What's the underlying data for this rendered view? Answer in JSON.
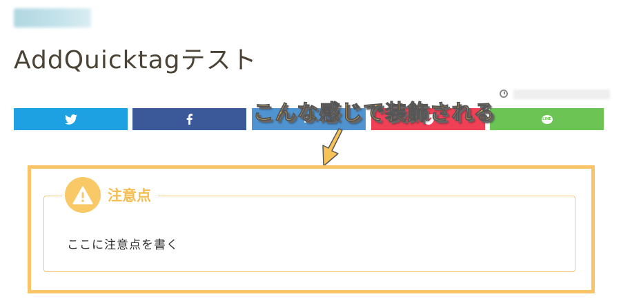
{
  "post": {
    "title": "AddQuicktagテスト"
  },
  "meta": {
    "clock_icon": "clock-icon"
  },
  "share": {
    "buttons": [
      {
        "service": "twitter",
        "icon": "twitter-bird-icon",
        "color": "#1da1e2"
      },
      {
        "service": "facebook",
        "icon": "facebook-f-icon",
        "color": "#3b5998"
      },
      {
        "service": "hatena",
        "icon": "hatena-icon",
        "color": "#4f93d0"
      },
      {
        "service": "pocket",
        "icon": "pocket-icon",
        "color": "#ef4056"
      },
      {
        "service": "line",
        "icon": "line-icon",
        "color": "#6cc455",
        "label": "LINE"
      }
    ]
  },
  "annotation": {
    "text": "こんな感じで装飾される",
    "color": "#f7c258"
  },
  "caution": {
    "label": "注意点",
    "body": "ここに注意点を書く",
    "accent_color": "#f9c867",
    "icon": "warning-icon"
  }
}
